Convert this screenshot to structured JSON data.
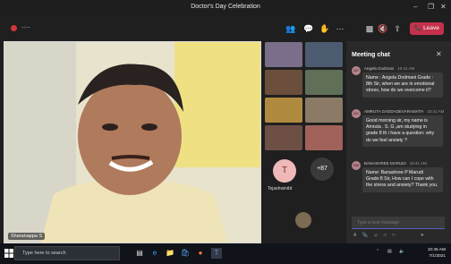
{
  "window": {
    "title": "Doctor's Day Celebration"
  },
  "toolbar": {
    "timer": "--:--",
    "leave_label": "Leave"
  },
  "speaker": {
    "name": "Sharanappa S"
  },
  "participants": {
    "avatar_initial": "T",
    "avatar_name": "Tejashwinibt",
    "more_count": "+87"
  },
  "chat": {
    "title": "Meeting chat",
    "placeholder": "Type a new message",
    "messages": [
      {
        "initials": "AD",
        "author": "Angela Dodmani",
        "time": "10:41 AM",
        "text": "Name : Angela Dodmani Grade : 8th Sir, when we are in emotional stress, how do we overcome it?"
      },
      {
        "initials": "AG",
        "author": "AMRUTA GADDADEVARAMATH",
        "time": "10:41 AM",
        "text": "Good morning sir, my name is Amruta . S. G ,am studying in grade 8 th i have a question: why do we feel anxiety ?"
      },
      {
        "initials": "BM",
        "author": "BANASHREE MARUDI",
        "time": "10:41 AM",
        "text": "Name: Banashree P Marudi Grade:8 Sir, How can I cope with the stress and anxiety? Thank you."
      }
    ]
  },
  "taskbar": {
    "search_placeholder": "Type here to search",
    "time": "10:45 AM",
    "date": "7/1/2021"
  },
  "colors": {
    "accent": "#5b5fc7",
    "leave": "#c4314b",
    "record": "#d13438"
  }
}
